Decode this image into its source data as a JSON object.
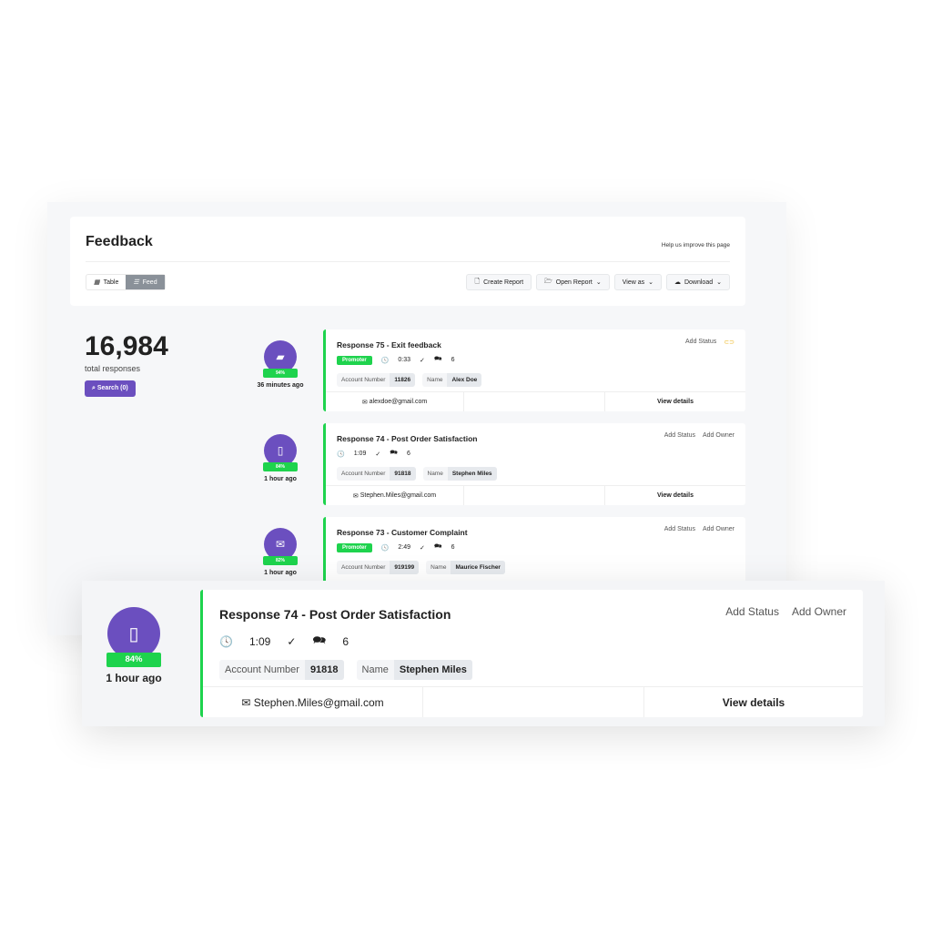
{
  "header": {
    "title": "Feedback",
    "help": "Help us improve this page",
    "view_table": "Table",
    "view_feed": "Feed",
    "create_report": "Create Report",
    "open_report": "Open Report",
    "view_as": "View as",
    "download": "Download"
  },
  "summary": {
    "total": "16,984",
    "label": "total responses",
    "search": "Search (0)"
  },
  "colors": {
    "accent": "#6b4fbf",
    "promoter": "#1ed34d"
  },
  "responses": [
    {
      "title": "Response 75 - Exit feedback",
      "badge": "Promoter",
      "duration": "0:33",
      "comments": "6",
      "account_label": "Account Number",
      "account": "11826",
      "name_label": "Name",
      "name": "Alex Doe",
      "email": "alexdoe@gmail.com",
      "view": "View details",
      "score": "94%",
      "ago": "36 minutes ago",
      "add_status": "Add Status",
      "icon": "chat-icon"
    },
    {
      "title": "Response 74 - Post Order Satisfaction",
      "duration": "1:09",
      "comments": "6",
      "account_label": "Account Number",
      "account": "91818",
      "name_label": "Name",
      "name": "Stephen Miles",
      "email": "Stephen.Miles@gmail.com",
      "view": "View details",
      "score": "84%",
      "ago": "1 hour ago",
      "add_status": "Add Status",
      "add_owner": "Add Owner",
      "icon": "mobile-icon"
    },
    {
      "title": "Response 73 - Customer Complaint",
      "badge": "Promoter",
      "duration": "2:49",
      "comments": "6",
      "account_label": "Account Number",
      "account": "919199",
      "name_label": "Name",
      "name": "Maurice Fischer",
      "score": "82%",
      "ago": "1 hour ago",
      "add_status": "Add Status",
      "add_owner": "Add Owner",
      "icon": "mail-icon"
    }
  ]
}
